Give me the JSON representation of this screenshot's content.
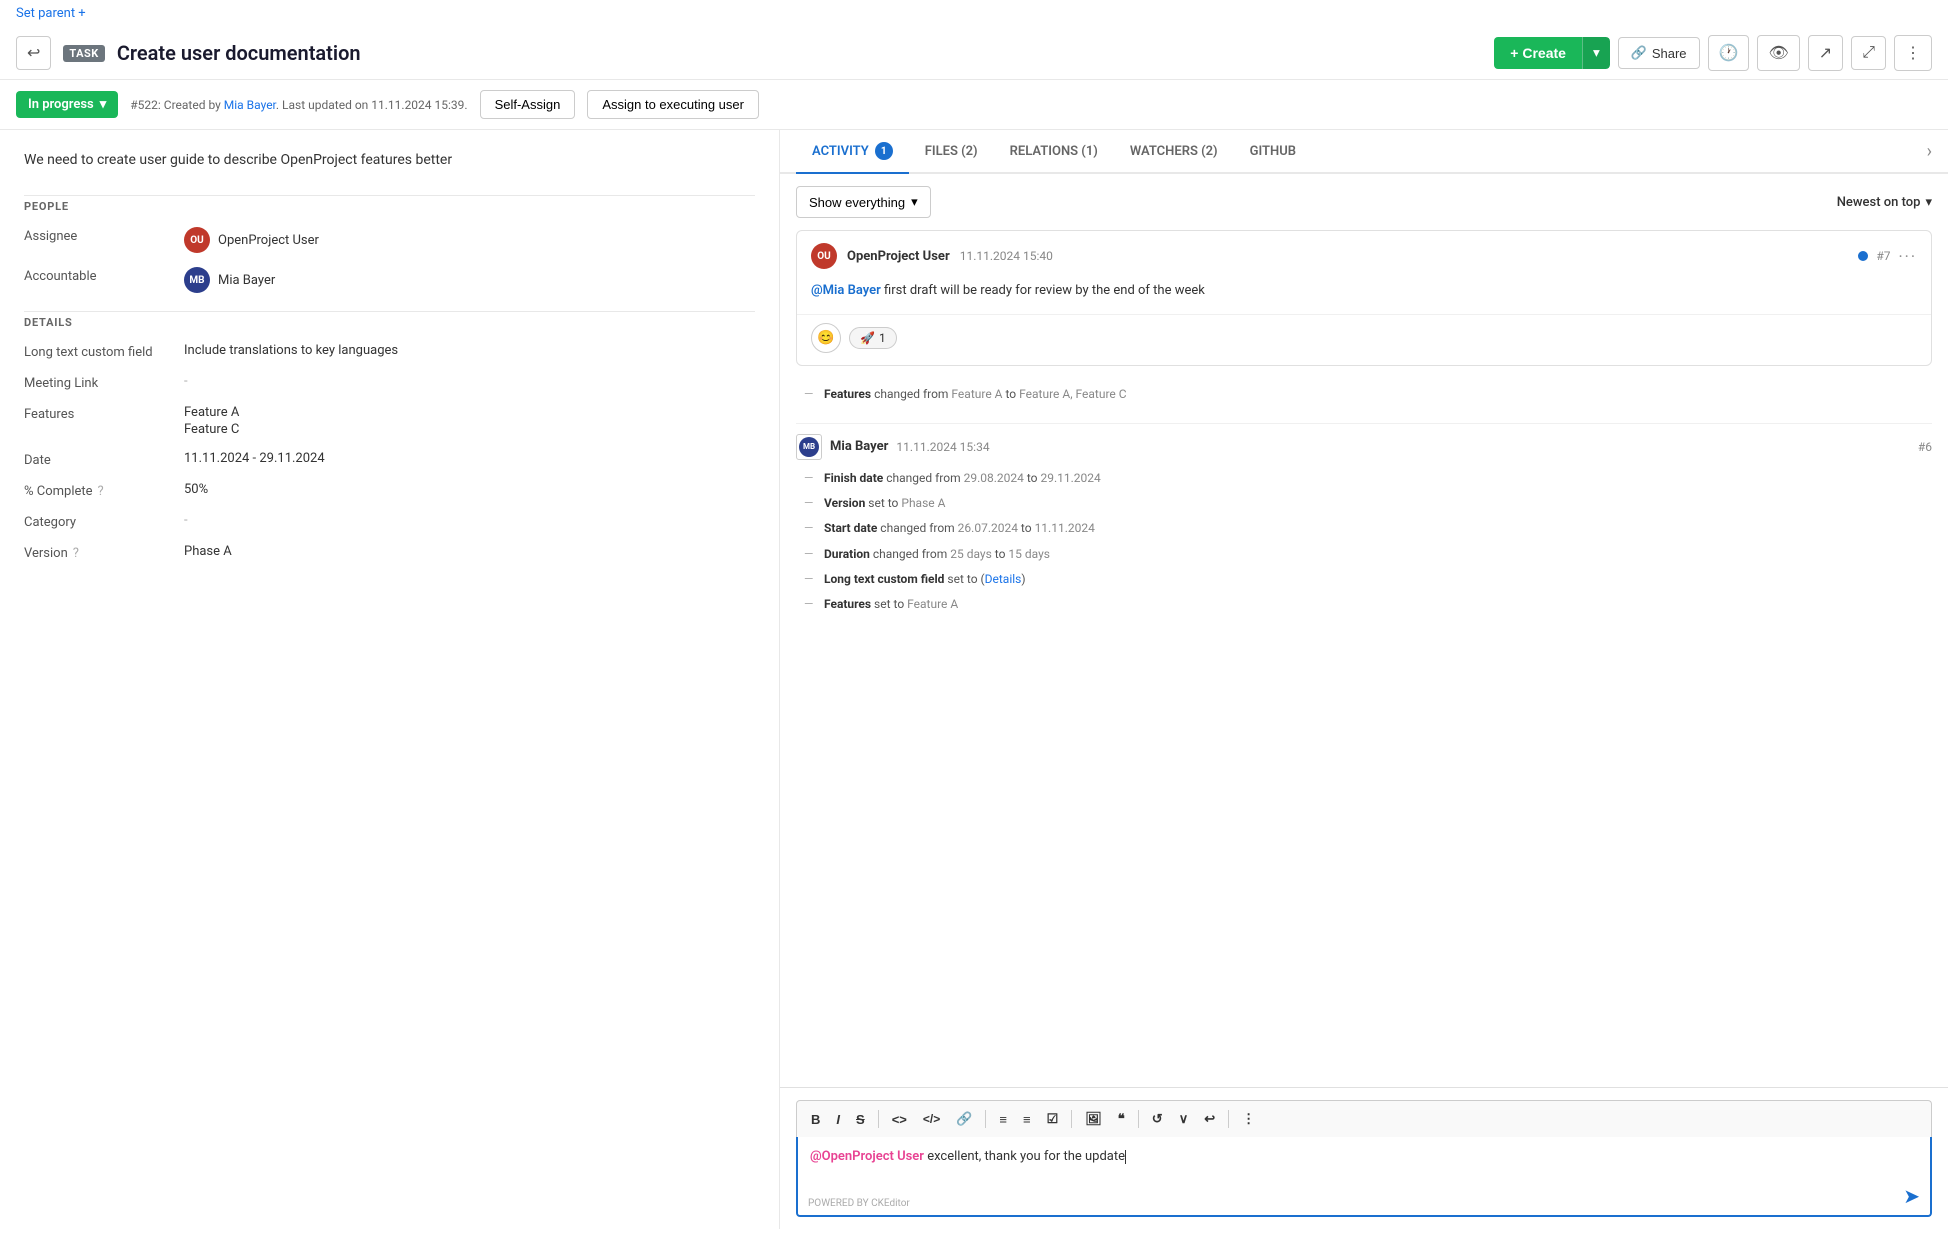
{
  "topbar": {
    "set_parent_label": "Set parent +"
  },
  "header": {
    "task_badge": "TASK",
    "title": "Create user documentation",
    "back_icon": "↩",
    "create_label": "+ Create",
    "share_label": "Share",
    "share_icon": "🔗"
  },
  "status_bar": {
    "status_label": "In progress",
    "task_info": "#522: Created by ",
    "task_creator": "Mia Bayer",
    "task_info_2": ". Last updated on 11.11.2024 15:39.",
    "self_assign_label": "Self-Assign",
    "assign_exec_label": "Assign to executing user"
  },
  "description": "We need to create user guide to describe OpenProject features better",
  "sections": {
    "people": {
      "title": "PEOPLE",
      "fields": [
        {
          "label": "Assignee",
          "type": "avatar",
          "avatar_class": "avatar-ou",
          "avatar_initials": "OU",
          "value": "OpenProject User"
        },
        {
          "label": "Accountable",
          "type": "avatar",
          "avatar_class": "avatar-mb",
          "avatar_initials": "MB",
          "value": "Mia Bayer"
        }
      ]
    },
    "details": {
      "title": "DETAILS",
      "fields": [
        {
          "label": "Long text custom field",
          "value": "Include translations to key languages",
          "type": "text"
        },
        {
          "label": "Meeting Link",
          "value": "-",
          "type": "dash"
        },
        {
          "label": "Features",
          "values": [
            "Feature A",
            "Feature C"
          ],
          "type": "multi"
        },
        {
          "label": "Date",
          "value": "11.11.2024 - 29.11.2024",
          "type": "text"
        },
        {
          "label": "% Complete",
          "value": "50%",
          "type": "text",
          "has_help": true
        },
        {
          "label": "Category",
          "value": "-",
          "type": "dash"
        },
        {
          "label": "Version",
          "value": "Phase A",
          "type": "text",
          "has_help": true
        }
      ]
    }
  },
  "tabs": [
    {
      "id": "activity",
      "label": "ACTIVITY",
      "badge": "1",
      "active": true
    },
    {
      "id": "files",
      "label": "FILES (2)",
      "active": false
    },
    {
      "id": "relations",
      "label": "RELATIONS (1)",
      "active": false
    },
    {
      "id": "watchers",
      "label": "WATCHERS (2)",
      "active": false
    },
    {
      "id": "github",
      "label": "GITHUB",
      "active": false
    }
  ],
  "filter": {
    "show_everything": "Show everything",
    "newest_on_top": "Newest on top"
  },
  "activity": {
    "comment": {
      "user_initials": "OU",
      "user_name": "OpenProject User",
      "time": "11.11.2024 15:40",
      "number": "#7",
      "mention": "@Mia Bayer",
      "body_text": " first draft will be ready for review by the end of the week",
      "emoji_label": "😊",
      "reaction_emoji": "🚀",
      "reaction_count": "1"
    },
    "change_block": {
      "text": "Features changed from Feature A to Feature A, Feature C"
    },
    "entry": {
      "user_initials": "MB",
      "user_name": "Mia Bayer",
      "time": "11.11.2024 15:34",
      "number": "#6",
      "changes": [
        {
          "label": "Finish date",
          "text": " changed from ",
          "from": "29.08.2024",
          "mid": " to ",
          "to": "29.11.2024"
        },
        {
          "label": "Version",
          "text": " set to ",
          "value": "Phase A"
        },
        {
          "label": "Start date",
          "text": " changed from ",
          "from": "26.07.2024",
          "mid": " to ",
          "to": "11.11.2024"
        },
        {
          "label": "Duration",
          "text": " changed from ",
          "from": "25 days",
          "mid": " to ",
          "to": "15 days"
        },
        {
          "label": "Long text custom field",
          "text": " set to ",
          "link": "Details"
        },
        {
          "label": "Features",
          "text": " set to ",
          "value": "Feature A"
        }
      ]
    }
  },
  "composer": {
    "mention": "@OpenProject User",
    "body_text": " excellent, thank you for the update",
    "powered_by": "POWERED BY CKEditor",
    "toolbar": [
      "B",
      "I",
      "S",
      "<>",
      "</>",
      "🔗",
      "≡",
      "≡",
      "☑",
      "🖼",
      "❝",
      "↺",
      "∨",
      "↩",
      "⋮"
    ]
  }
}
